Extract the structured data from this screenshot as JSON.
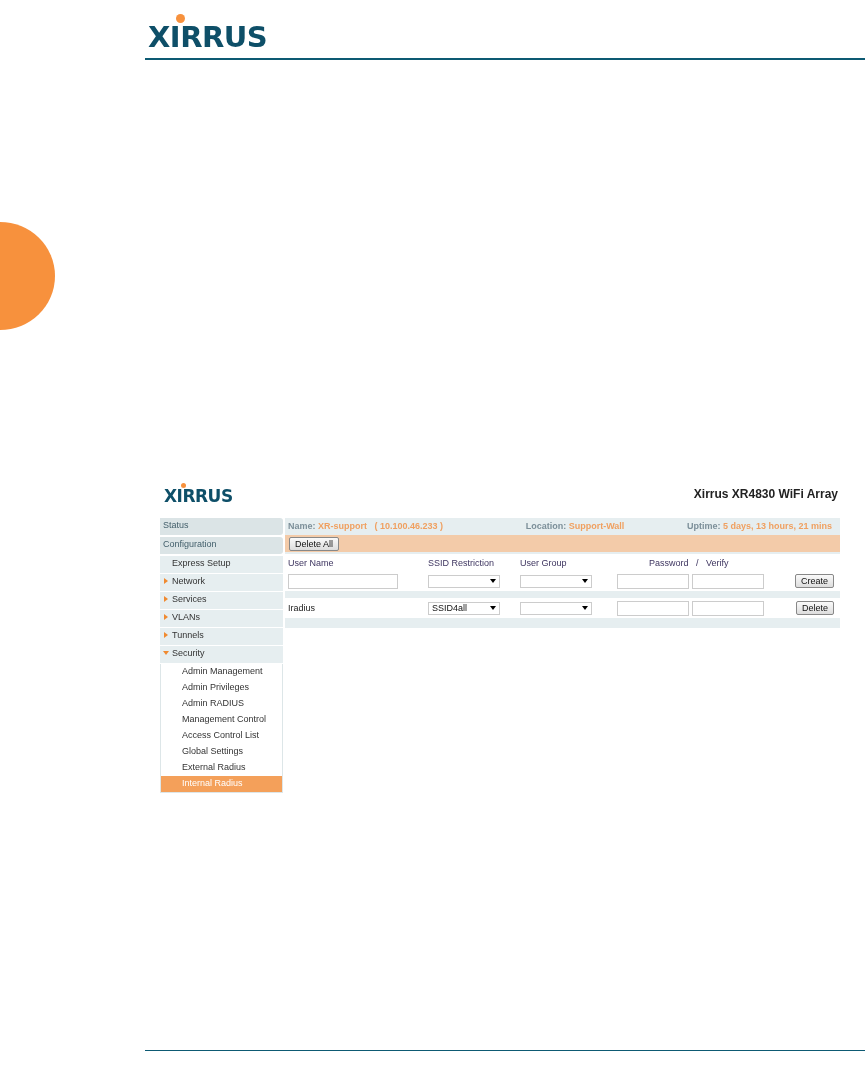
{
  "header": {
    "logo": "XIRRUS"
  },
  "app": {
    "logo": "XIRRUS",
    "title": "Xirrus XR4830 WiFi Array",
    "info": [
      {
        "label": "Name:",
        "value": "XR-support   ( 10.100.46.233 )"
      },
      {
        "label": "Location:",
        "value": "Support-Wall"
      },
      {
        "label": "Uptime:",
        "value": "5 days, 13 hours, 21 mins"
      }
    ],
    "sidebar": [
      {
        "kind": "header",
        "label": "Status"
      },
      {
        "kind": "header",
        "label": "Configuration"
      },
      {
        "kind": "item",
        "label": "Express Setup"
      },
      {
        "kind": "group",
        "label": "Network",
        "expanded": false
      },
      {
        "kind": "group",
        "label": "Services",
        "expanded": false
      },
      {
        "kind": "group",
        "label": "VLANs",
        "expanded": false
      },
      {
        "kind": "group",
        "label": "Tunnels",
        "expanded": false
      },
      {
        "kind": "group",
        "label": "Security",
        "expanded": true,
        "children": [
          {
            "label": "Admin Management",
            "selected": false
          },
          {
            "label": "Admin Privileges",
            "selected": false
          },
          {
            "label": "Admin RADIUS",
            "selected": false
          },
          {
            "label": "Management Control",
            "selected": false
          },
          {
            "label": "Access Control List",
            "selected": false
          },
          {
            "label": "Global Settings",
            "selected": false
          },
          {
            "label": "External Radius",
            "selected": false
          },
          {
            "label": "Internal Radius",
            "selected": true
          }
        ]
      }
    ],
    "delete_all": "Delete All",
    "columns": [
      "User Name",
      "SSID Restriction",
      "User Group",
      "Password   /   Verify"
    ],
    "create": "Create",
    "rows": [
      {
        "user": "Iradius",
        "ssid": "SSID4all",
        "button": "Delete"
      }
    ]
  }
}
